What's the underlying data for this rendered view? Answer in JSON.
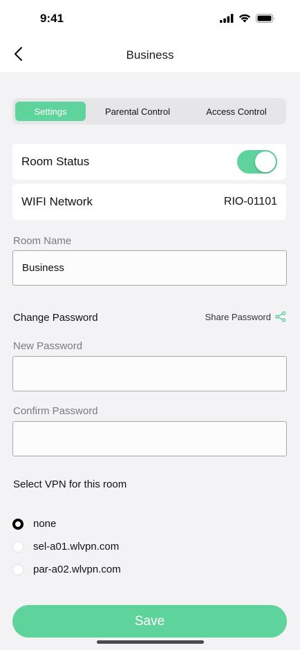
{
  "status_bar": {
    "time": "9:41",
    "icons": [
      "signal-icon",
      "wifi-icon",
      "battery-icon"
    ]
  },
  "nav": {
    "title": "Business",
    "back_icon": "chevron-left-icon"
  },
  "tabs": [
    {
      "label": "Settings",
      "active": true
    },
    {
      "label": "Parental Control",
      "active": false
    },
    {
      "label": "Access Control",
      "active": false
    }
  ],
  "room_status": {
    "label": "Room Status",
    "enabled": true
  },
  "wifi": {
    "label": "WIFI Network",
    "value": "RIO-01101"
  },
  "room_name": {
    "label": "Room Name",
    "value": "Business"
  },
  "password": {
    "section_title": "Change Password",
    "share_label": "Share Password",
    "share_icon": "share-icon",
    "new_label": "New Password",
    "new_value": "",
    "confirm_label": "Confirm Password",
    "confirm_value": ""
  },
  "vpn": {
    "title": "Select VPN for this room",
    "options": [
      {
        "label": "none",
        "selected": true
      },
      {
        "label": "sel-a01.wlvpn.com",
        "selected": false
      },
      {
        "label": "par-a02.wlvpn.com",
        "selected": false
      }
    ]
  },
  "save_label": "Save",
  "colors": {
    "accent": "#5fd39c",
    "background": "#f3f3f5"
  }
}
